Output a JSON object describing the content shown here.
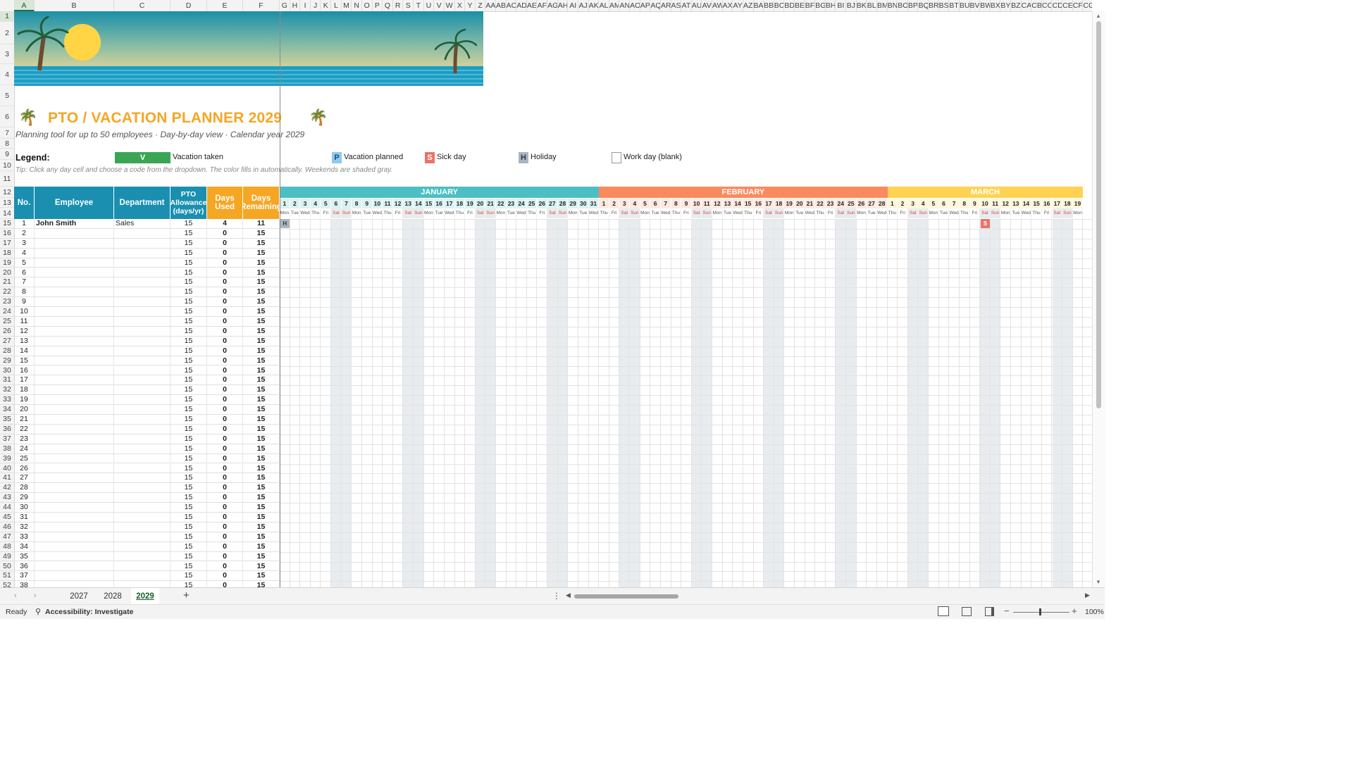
{
  "columns": [
    "A",
    "B",
    "C",
    "D",
    "E",
    "F",
    "G",
    "H",
    "I",
    "J",
    "K",
    "L",
    "M",
    "N",
    "O",
    "P",
    "Q",
    "R",
    "S",
    "T",
    "U",
    "V",
    "W",
    "X",
    "Y",
    "Z",
    "AA",
    "AB",
    "AC",
    "AD",
    "AE",
    "AF",
    "AG",
    "AH",
    "AI",
    "AJ",
    "AK",
    "AL",
    "AM",
    "AN",
    "AO",
    "AP",
    "AQ",
    "AR",
    "AS",
    "AT",
    "AU",
    "AV",
    "AW",
    "AX",
    "AY",
    "AZ",
    "BA",
    "BB",
    "BC",
    "BD",
    "BE",
    "BF",
    "BG",
    "BH",
    "BI",
    "BJ",
    "BK",
    "BL",
    "BM",
    "BN",
    "BO",
    "BP",
    "BQ",
    "BR",
    "BS",
    "BT",
    "BU",
    "BV",
    "BW",
    "BX",
    "BY",
    "BZ",
    "CA",
    "CB",
    "CC",
    "CD",
    "CE",
    "CF",
    "CG"
  ],
  "title": "PTO / VACATION PLANNER 2029",
  "subtitle": "Planning tool for up to 50 employees  ·  Day-by-day view  ·  Calendar year 2029",
  "legend": {
    "label": "Legend:",
    "items": [
      {
        "code": "V",
        "text": "Vacation taken",
        "color": "#3aa655"
      },
      {
        "code": "P",
        "text": "Vacation planned",
        "color": "#8ec9ee"
      },
      {
        "code": "S",
        "text": "Sick day",
        "color": "#e8746a"
      },
      {
        "code": "H",
        "text": "Holiday",
        "color": "#a9b6c0"
      },
      {
        "code": "",
        "text": "Work day (blank)",
        "color": "#ffffff"
      }
    ]
  },
  "tip": "Tip: Click any day cell and choose a code from the dropdown. The color fills in automatically. Weekends are shaded gray.",
  "table": {
    "headers": {
      "no": "No.",
      "employee": "Employee",
      "department": "Department",
      "allowance": "PTO Allowance (days/yr)",
      "used": "Days Used",
      "remaining": "Days Remaining"
    },
    "rows": [
      {
        "no": "1",
        "employee": "John Smith",
        "department": "Sales",
        "allowance": "15",
        "used": "4",
        "remaining": "11"
      },
      {
        "no": "2",
        "employee": "",
        "department": "",
        "allowance": "15",
        "used": "0",
        "remaining": "15"
      },
      {
        "no": "3",
        "employee": "",
        "department": "",
        "allowance": "15",
        "used": "0",
        "remaining": "15"
      },
      {
        "no": "4",
        "employee": "",
        "department": "",
        "allowance": "15",
        "used": "0",
        "remaining": "15"
      },
      {
        "no": "5",
        "employee": "",
        "department": "",
        "allowance": "15",
        "used": "0",
        "remaining": "15"
      },
      {
        "no": "6",
        "employee": "",
        "department": "",
        "allowance": "15",
        "used": "0",
        "remaining": "15"
      },
      {
        "no": "7",
        "employee": "",
        "department": "",
        "allowance": "15",
        "used": "0",
        "remaining": "15"
      },
      {
        "no": "8",
        "employee": "",
        "department": "",
        "allowance": "15",
        "used": "0",
        "remaining": "15"
      },
      {
        "no": "9",
        "employee": "",
        "department": "",
        "allowance": "15",
        "used": "0",
        "remaining": "15"
      },
      {
        "no": "10",
        "employee": "",
        "department": "",
        "allowance": "15",
        "used": "0",
        "remaining": "15"
      },
      {
        "no": "11",
        "employee": "",
        "department": "",
        "allowance": "15",
        "used": "0",
        "remaining": "15"
      },
      {
        "no": "12",
        "employee": "",
        "department": "",
        "allowance": "15",
        "used": "0",
        "remaining": "15"
      },
      {
        "no": "13",
        "employee": "",
        "department": "",
        "allowance": "15",
        "used": "0",
        "remaining": "15"
      },
      {
        "no": "14",
        "employee": "",
        "department": "",
        "allowance": "15",
        "used": "0",
        "remaining": "15"
      },
      {
        "no": "15",
        "employee": "",
        "department": "",
        "allowance": "15",
        "used": "0",
        "remaining": "15"
      },
      {
        "no": "16",
        "employee": "",
        "department": "",
        "allowance": "15",
        "used": "0",
        "remaining": "15"
      },
      {
        "no": "17",
        "employee": "",
        "department": "",
        "allowance": "15",
        "used": "0",
        "remaining": "15"
      },
      {
        "no": "18",
        "employee": "",
        "department": "",
        "allowance": "15",
        "used": "0",
        "remaining": "15"
      },
      {
        "no": "19",
        "employee": "",
        "department": "",
        "allowance": "15",
        "used": "0",
        "remaining": "15"
      },
      {
        "no": "20",
        "employee": "",
        "department": "",
        "allowance": "15",
        "used": "0",
        "remaining": "15"
      },
      {
        "no": "21",
        "employee": "",
        "department": "",
        "allowance": "15",
        "used": "0",
        "remaining": "15"
      },
      {
        "no": "22",
        "employee": "",
        "department": "",
        "allowance": "15",
        "used": "0",
        "remaining": "15"
      },
      {
        "no": "23",
        "employee": "",
        "department": "",
        "allowance": "15",
        "used": "0",
        "remaining": "15"
      },
      {
        "no": "24",
        "employee": "",
        "department": "",
        "allowance": "15",
        "used": "0",
        "remaining": "15"
      },
      {
        "no": "25",
        "employee": "",
        "department": "",
        "allowance": "15",
        "used": "0",
        "remaining": "15"
      },
      {
        "no": "26",
        "employee": "",
        "department": "",
        "allowance": "15",
        "used": "0",
        "remaining": "15"
      },
      {
        "no": "27",
        "employee": "",
        "department": "",
        "allowance": "15",
        "used": "0",
        "remaining": "15"
      },
      {
        "no": "28",
        "employee": "",
        "department": "",
        "allowance": "15",
        "used": "0",
        "remaining": "15"
      },
      {
        "no": "29",
        "employee": "",
        "department": "",
        "allowance": "15",
        "used": "0",
        "remaining": "15"
      },
      {
        "no": "30",
        "employee": "",
        "department": "",
        "allowance": "15",
        "used": "0",
        "remaining": "15"
      },
      {
        "no": "31",
        "employee": "",
        "department": "",
        "allowance": "15",
        "used": "0",
        "remaining": "15"
      },
      {
        "no": "32",
        "employee": "",
        "department": "",
        "allowance": "15",
        "used": "0",
        "remaining": "15"
      },
      {
        "no": "33",
        "employee": "",
        "department": "",
        "allowance": "15",
        "used": "0",
        "remaining": "15"
      },
      {
        "no": "34",
        "employee": "",
        "department": "",
        "allowance": "15",
        "used": "0",
        "remaining": "15"
      },
      {
        "no": "35",
        "employee": "",
        "department": "",
        "allowance": "15",
        "used": "0",
        "remaining": "15"
      },
      {
        "no": "36",
        "employee": "",
        "department": "",
        "allowance": "15",
        "used": "0",
        "remaining": "15"
      },
      {
        "no": "37",
        "employee": "",
        "department": "",
        "allowance": "15",
        "used": "0",
        "remaining": "15"
      },
      {
        "no": "38",
        "employee": "",
        "department": "",
        "allowance": "15",
        "used": "0",
        "remaining": "15"
      }
    ]
  },
  "calendar": {
    "months": [
      {
        "name": "JANUARY",
        "days": 31,
        "color": "#4bbfc4"
      },
      {
        "name": "FEBRUARY",
        "days": 28,
        "color": "#fa8a5e"
      },
      {
        "name": "MARCH",
        "days": 19,
        "color": "#ffd351"
      }
    ],
    "weekdays": [
      "Mon",
      "Tue",
      "Wed",
      "Thu",
      "Fri",
      "Sat",
      "Sun"
    ],
    "weekend_color": "#e8ecef",
    "weekend_text_color": "#d9463b",
    "marks": [
      {
        "row": 1,
        "month": "JANUARY",
        "day": 1,
        "code": "H",
        "color": "#a9b6c0"
      },
      {
        "row": 1,
        "month": "MARCH",
        "day": 10,
        "code": "S",
        "color": "#e8746a"
      }
    ]
  },
  "sheet_tabs": [
    {
      "label": "2027",
      "active": false
    },
    {
      "label": "2028",
      "active": false
    },
    {
      "label": "2029",
      "active": true
    }
  ],
  "status": {
    "ready": "Ready",
    "accessibility": "Accessibility: Investigate",
    "zoom": "100%"
  },
  "first_row_number": 15,
  "selected_column": "A",
  "selected_row": "1"
}
